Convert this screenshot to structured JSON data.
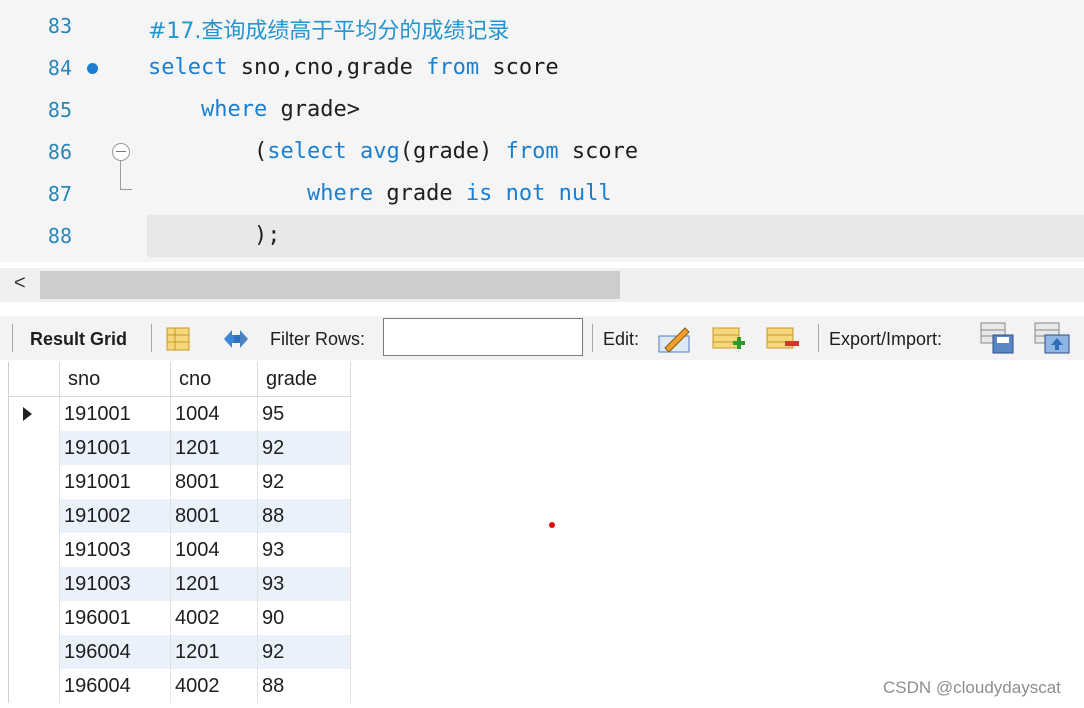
{
  "editor": {
    "lines": [
      {
        "num": "83",
        "parts": [
          {
            "t": "#17.查询成绩高于平均分的成绩记录",
            "c": "cm"
          }
        ]
      },
      {
        "num": "84",
        "parts": [
          {
            "t": "select",
            "c": "kw"
          },
          {
            "t": " sno,cno,grade ",
            "c": ""
          },
          {
            "t": "from",
            "c": "kw"
          },
          {
            "t": " score",
            "c": ""
          }
        ]
      },
      {
        "num": "85",
        "parts": [
          {
            "t": "    ",
            "c": ""
          },
          {
            "t": "where",
            "c": "kw"
          },
          {
            "t": " grade>",
            "c": ""
          }
        ]
      },
      {
        "num": "86",
        "parts": [
          {
            "t": "        (",
            "c": ""
          },
          {
            "t": "select",
            "c": "kw"
          },
          {
            "t": " ",
            "c": ""
          },
          {
            "t": "avg",
            "c": "kw"
          },
          {
            "t": "(grade) ",
            "c": ""
          },
          {
            "t": "from",
            "c": "kw"
          },
          {
            "t": " score",
            "c": ""
          }
        ]
      },
      {
        "num": "87",
        "parts": [
          {
            "t": "            ",
            "c": ""
          },
          {
            "t": "where",
            "c": "kw"
          },
          {
            "t": " grade ",
            "c": ""
          },
          {
            "t": "is",
            "c": "kw"
          },
          {
            "t": " ",
            "c": ""
          },
          {
            "t": "not",
            "c": "kw"
          },
          {
            "t": " ",
            "c": ""
          },
          {
            "t": "null",
            "c": "kw"
          }
        ]
      },
      {
        "num": "88",
        "parts": [
          {
            "t": "        );",
            "c": ""
          }
        ]
      }
    ]
  },
  "scrollbar": {
    "left_arrow": "<"
  },
  "toolbar": {
    "result_grid_label": "Result Grid",
    "filter_rows_label": "Filter Rows:",
    "filter_value": "",
    "edit_label": "Edit:",
    "export_import_label": "Export/Import:"
  },
  "grid": {
    "columns": [
      "sno",
      "cno",
      "grade"
    ],
    "rows": [
      [
        "191001",
        "1004",
        "95"
      ],
      [
        "191001",
        "1201",
        "92"
      ],
      [
        "191001",
        "8001",
        "92"
      ],
      [
        "191002",
        "8001",
        "88"
      ],
      [
        "191003",
        "1004",
        "93"
      ],
      [
        "191003",
        "1201",
        "93"
      ],
      [
        "196001",
        "4002",
        "90"
      ],
      [
        "196004",
        "1201",
        "92"
      ],
      [
        "196004",
        "4002",
        "88"
      ]
    ]
  },
  "watermark": "CSDN @cloudydayscat",
  "colors": {
    "keyword": "#1a7fd0",
    "comment": "#2294cf",
    "line_number": "#2a86b5",
    "alt_row": "#eaf1fb"
  }
}
